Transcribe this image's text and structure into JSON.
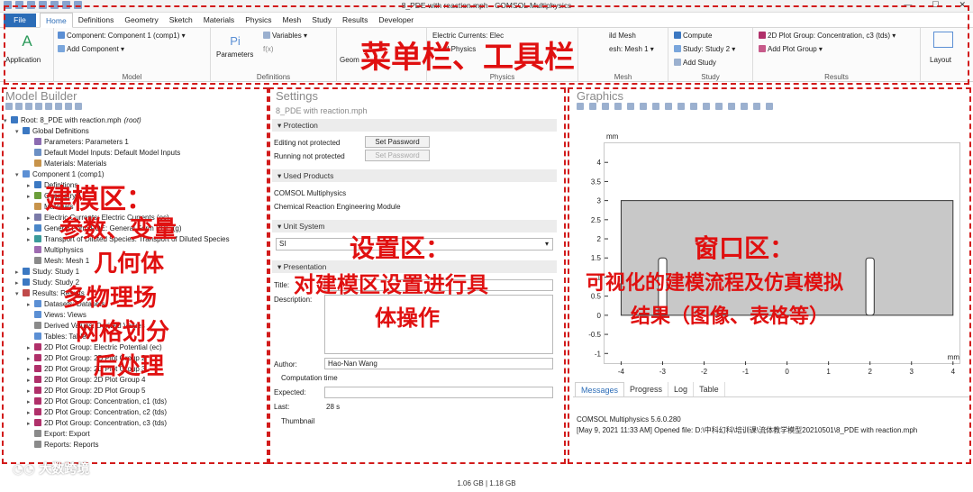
{
  "window": {
    "title": "8_PDE with reaction.mph - COMSOL Multiphysics",
    "min_glyph": "—",
    "max_glyph": "☐",
    "close_glyph": "✕"
  },
  "menubar": {
    "file": "File",
    "tabs": [
      "Home",
      "Definitions",
      "Geometry",
      "Sketch",
      "Materials",
      "Physics",
      "Mesh",
      "Study",
      "Results",
      "Developer"
    ]
  },
  "ribbon": {
    "application_label": "Application",
    "component": "Component: Component 1 (comp1) ▾",
    "add_component": "Add Component ▾",
    "model_group": "Model",
    "parameters_label": "Parameters",
    "variables": "Variables ▾",
    "fx_label": "f(x)",
    "definitions_group": "Definitions",
    "geometry_label": "Geom",
    "physics_current": "Electric Currents: Elec",
    "physics_sub": "d Physics",
    "physics_group": "Physics",
    "build_mesh": "ild Mesh",
    "mesh_select": "esh: Mesh 1 ▾",
    "mesh_group": "Mesh",
    "compute": "Compute",
    "study_select": "Study: Study 2 ▾",
    "add_study": "Add Study",
    "study_group": "Study",
    "plot_group": "2D Plot Group: Concentration, c3 (tds) ▾",
    "add_plot_group": "Add Plot Group ▾",
    "results_group": "Results",
    "layout_label": "Layout"
  },
  "model_builder": {
    "title": "Model Builder",
    "nodes": [
      {
        "label": "Root: 8_PDE with reaction.mph",
        "suffix": "(root)",
        "level": 0,
        "twisty": "▾",
        "color": "#3b78c2"
      },
      {
        "label": "Global Definitions",
        "level": 1,
        "twisty": "▾",
        "color": "#3b78c2"
      },
      {
        "label": "Parameters: Parameters 1",
        "level": 2,
        "twisty": "",
        "color": "#8c6bb1"
      },
      {
        "label": "Default Model Inputs: Default Model Inputs",
        "level": 2,
        "twisty": "",
        "color": "#6b8fc4"
      },
      {
        "label": "Materials: Materials",
        "level": 2,
        "twisty": "",
        "color": "#c7934a"
      },
      {
        "label": "Component 1 (comp1)",
        "level": 1,
        "twisty": "▾",
        "color": "#5b8fd4"
      },
      {
        "label": "Definitions",
        "level": 2,
        "twisty": "▸",
        "color": "#3b78c2"
      },
      {
        "label": "Geometry 1",
        "level": 2,
        "twisty": "▸",
        "color": "#6b9e3a"
      },
      {
        "label": "Materials",
        "level": 2,
        "twisty": "",
        "color": "#c7934a"
      },
      {
        "label": "Electric Currents: Electric Currents (ec)",
        "level": 2,
        "twisty": "▸",
        "color": "#7a7aa8"
      },
      {
        "label": "General Form PDE: General Form PDE (g)",
        "level": 2,
        "twisty": "▸",
        "color": "#4a86c8"
      },
      {
        "label": "Transport of Diluted Species: Transport of Diluted Species",
        "level": 2,
        "twisty": "▸",
        "color": "#3a9a9a"
      },
      {
        "label": "Multiphysics",
        "level": 2,
        "twisty": "",
        "color": "#9e6bb1"
      },
      {
        "label": "Mesh: Mesh 1",
        "level": 2,
        "twisty": "",
        "color": "#8a8a8a"
      },
      {
        "label": "Study: Study 1",
        "level": 1,
        "twisty": "▸",
        "color": "#3b78c2"
      },
      {
        "label": "Study: Study 2",
        "level": 1,
        "twisty": "▸",
        "color": "#3b78c2"
      },
      {
        "label": "Results: Results",
        "level": 1,
        "twisty": "▾",
        "color": "#c04a4a"
      },
      {
        "label": "Datasets: Datasets",
        "level": 2,
        "twisty": "▸",
        "color": "#5b8fd4"
      },
      {
        "label": "Views: Views",
        "level": 2,
        "twisty": "",
        "color": "#5b8fd4"
      },
      {
        "label": "Derived Values: Derived Values",
        "level": 2,
        "twisty": "",
        "color": "#8a8a8a"
      },
      {
        "label": "Tables: Tables",
        "level": 2,
        "twisty": "",
        "color": "#5b8fd4"
      },
      {
        "label": "2D Plot Group: Electric Potential (ec)",
        "level": 2,
        "twisty": "▸",
        "color": "#b0306a"
      },
      {
        "label": "2D Plot Group: 2D Plot Group 2",
        "level": 2,
        "twisty": "▸",
        "color": "#b0306a"
      },
      {
        "label": "2D Plot Group: 2D Plot Group 3",
        "level": 2,
        "twisty": "▸",
        "color": "#b0306a"
      },
      {
        "label": "2D Plot Group: 2D Plot Group 4",
        "level": 2,
        "twisty": "▸",
        "color": "#b0306a"
      },
      {
        "label": "2D Plot Group: 2D Plot Group 5",
        "level": 2,
        "twisty": "▸",
        "color": "#b0306a"
      },
      {
        "label": "2D Plot Group: Concentration, c1 (tds)",
        "level": 2,
        "twisty": "▸",
        "color": "#b0306a"
      },
      {
        "label": "2D Plot Group: Concentration, c2 (tds)",
        "level": 2,
        "twisty": "▸",
        "color": "#b0306a"
      },
      {
        "label": "2D Plot Group: Concentration, c3 (tds)",
        "level": 2,
        "twisty": "▸",
        "color": "#b0306a"
      },
      {
        "label": "Export: Export",
        "level": 2,
        "twisty": "",
        "color": "#8a8a8a"
      },
      {
        "label": "Reports: Reports",
        "level": 2,
        "twisty": "",
        "color": "#8a8a8a"
      }
    ]
  },
  "settings": {
    "title": "Settings",
    "subtitle": "8_PDE with reaction.mph",
    "protection": "Protection",
    "editing": "Editing not protected",
    "running": "Running not protected",
    "set_password": "Set Password",
    "used_products": "Used Products",
    "product1": "COMSOL Multiphysics",
    "product2": "Chemical Reaction Engineering Module",
    "unit_system": "Unit System",
    "unit_value": "SI",
    "presentation": "Presentation",
    "title_label": "Title:",
    "description_label": "Description:",
    "author_label": "Author:",
    "author_value": "Hao-Nan Wang",
    "computation_time": "Computation time",
    "expected_label": "Expected:",
    "last_label": "Last:",
    "last_value": "28 s",
    "thumbnail": "Thumbnail"
  },
  "graphics": {
    "title": "Graphics",
    "unit_y": "mm",
    "unit_x": "mm",
    "yticks": [
      "4",
      "3.5",
      "3",
      "2.5",
      "2",
      "1.5",
      "1",
      "0.5",
      "0",
      "-0.5",
      "-1"
    ],
    "xticks": [
      "-4",
      "-3",
      "-2",
      "-1",
      "0",
      "1",
      "2",
      "3",
      "4"
    ],
    "yrange": [
      -1.3,
      4.5
    ],
    "xrange": [
      -4.4,
      4.2
    ],
    "geometry_rect": {
      "x0": -4.0,
      "x1": 4.0,
      "y0": 0.0,
      "y1": 3.0
    },
    "geometry_slot1": {
      "x0": -3.1,
      "x1": -2.9,
      "y0": 0.0,
      "y1": 1.5
    },
    "geometry_slot2": {
      "x0": 1.9,
      "x1": 2.1,
      "y0": 0.0,
      "y1": 1.5
    }
  },
  "messages": {
    "tabs": [
      "Messages",
      "Progress",
      "Log",
      "Table"
    ],
    "line1": "COMSOL Multiphysics 5.6.0.280",
    "line2": "[May 9, 2021 11:33 AM] Opened file: D:\\中科幻科\\培训课\\流体教学模型20210501\\8_PDE with reaction.mph"
  },
  "status": {
    "memory": "1.06 GB | 1.18 GB"
  },
  "annotations": {
    "menu": "菜单栏、工具栏",
    "model_title": "建模区：",
    "model_items": [
      "参数、变量",
      "几何体",
      "多物理场",
      "网格划分",
      "后处理"
    ],
    "settings_title": "设置区：",
    "settings_desc1": "对建模区设置进行具",
    "settings_desc2": "体操作",
    "window_title": "窗口区：",
    "window_desc1": "可视化的建模流程及仿真模拟",
    "window_desc2": "结果（图像、表格等）",
    "watermark": "大数跨境"
  }
}
